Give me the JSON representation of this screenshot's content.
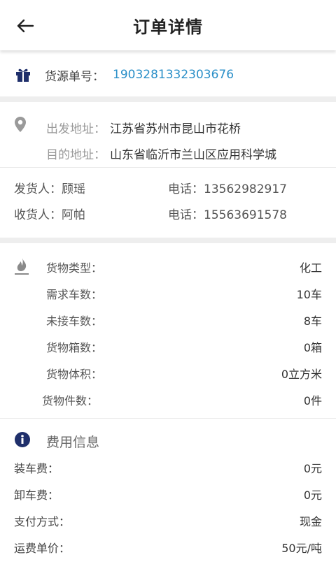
{
  "header": {
    "title": "订单详情",
    "back_icon": "arrow-left-icon"
  },
  "order": {
    "label": "货源单号：",
    "number": "1903281332303676",
    "icon": "gift-icon"
  },
  "address": {
    "from_label": "出发地址：",
    "from_value": "江苏省苏州市昆山市花桥",
    "to_label": "目的地址：",
    "to_value": "山东省临沂市兰山区应用科学城",
    "icon": "location-pin-icon"
  },
  "people": {
    "shipper_label": "发货人：",
    "shipper_name": "顾瑶",
    "shipper_phone_label": "电话：",
    "shipper_phone": "13562982917",
    "receiver_label": "收货人：",
    "receiver_name": "阿帕",
    "receiver_phone_label": "电话：",
    "receiver_phone": "15563691578"
  },
  "goods": {
    "icon": "flame-icon",
    "rows": [
      {
        "label": "货物类型：",
        "value": "化工"
      },
      {
        "label": "需求车数：",
        "value": "10车"
      },
      {
        "label": "未接车数：",
        "value": "8车"
      },
      {
        "label": "货物箱数：",
        "value": "0箱"
      },
      {
        "label": "货物体积：",
        "value": "0立方米"
      },
      {
        "label": "货物件数：",
        "value": "0件"
      }
    ]
  },
  "fee": {
    "icon": "info-icon",
    "title": "费用信息",
    "rows": [
      {
        "label": "装车费：",
        "value": "0元"
      },
      {
        "label": "卸车费：",
        "value": "0元"
      },
      {
        "label": "支付方式：",
        "value": "现金"
      },
      {
        "label": "运费单价：",
        "value": "50元/吨"
      }
    ]
  },
  "colors": {
    "accent": "#2a8fc8",
    "icon_dark": "#1f2f6b",
    "separator": "#eeeeee"
  }
}
